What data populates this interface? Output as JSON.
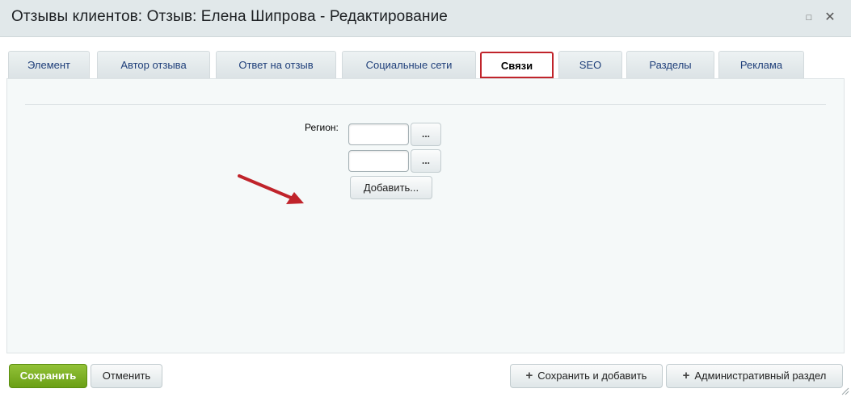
{
  "window": {
    "title": "Отзывы клиентов: Отзыв: Елена Шипрова - Редактирование",
    "maximize_glyph": "□",
    "close_glyph": "✕"
  },
  "tabs": [
    {
      "label": "Элемент",
      "active": false
    },
    {
      "label": "Автор отзыва",
      "active": false
    },
    {
      "label": "Ответ на отзыв",
      "active": false
    },
    {
      "label": "Социальные сети",
      "active": false
    },
    {
      "label": "Связи",
      "active": true
    },
    {
      "label": "SEO",
      "active": false
    },
    {
      "label": "Разделы",
      "active": false
    },
    {
      "label": "Реклама",
      "active": false
    }
  ],
  "form": {
    "region_label": "Регион:",
    "region_values": [
      "",
      ""
    ],
    "browse_label": "...",
    "add_label": "Добавить..."
  },
  "footer": {
    "save_label": "Сохранить",
    "cancel_label": "Отменить",
    "save_add_label": "Сохранить и добавить",
    "admin_label": "Административный раздел",
    "plus_glyph": "+"
  },
  "colors": {
    "highlight_red": "#c0242b",
    "save_green": "#7aad1f",
    "tab_text": "#1f3f7a"
  }
}
